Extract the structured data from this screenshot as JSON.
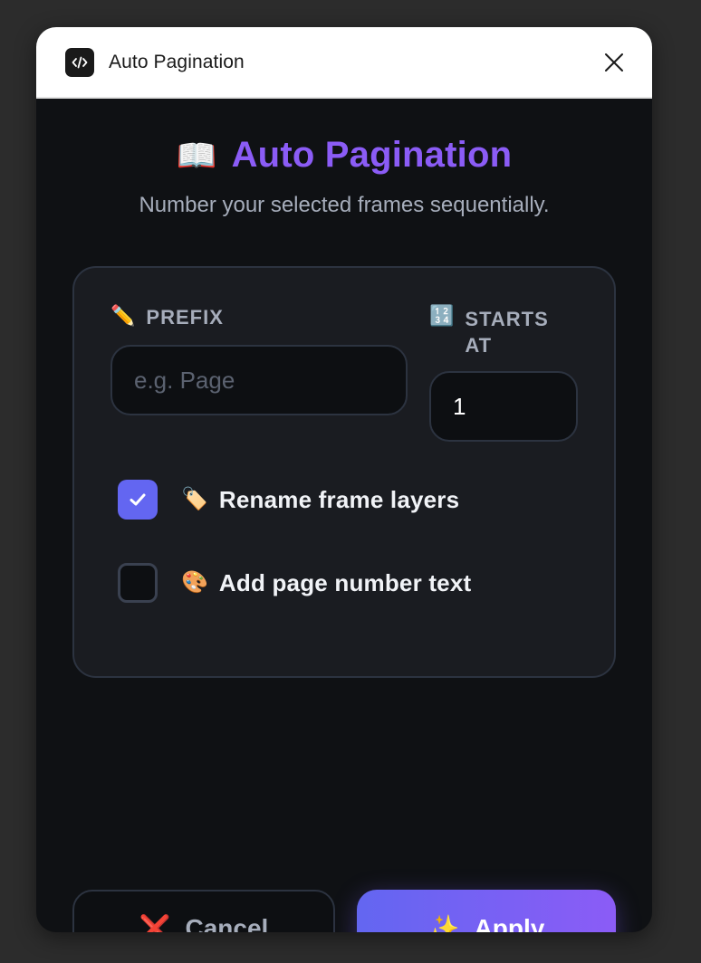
{
  "window": {
    "title": "Auto Pagination",
    "app_icon": "code-icon",
    "close_icon": "close-icon"
  },
  "header": {
    "emoji": "📖",
    "title": "Auto Pagination",
    "subtitle": "Number your selected frames sequentially."
  },
  "form": {
    "prefix": {
      "emoji": "✏️",
      "label": "PREFIX",
      "placeholder": "e.g. Page",
      "value": ""
    },
    "starts_at": {
      "emoji": "🔢",
      "label": "STARTS AT",
      "value": "1"
    },
    "options": [
      {
        "emoji": "🏷️",
        "label": "Rename frame layers",
        "checked": true
      },
      {
        "emoji": "🎨",
        "label": "Add page number text",
        "checked": false
      }
    ]
  },
  "actions": {
    "cancel": {
      "icon": "❌",
      "label": "Cancel"
    },
    "apply": {
      "icon": "✨",
      "label": "Apply"
    }
  },
  "colors": {
    "accent": "#8b5cf6",
    "checkbox_checked": "#6366f1",
    "apply_gradient_start": "#6366f1",
    "apply_gradient_end": "#8b5cf6"
  }
}
